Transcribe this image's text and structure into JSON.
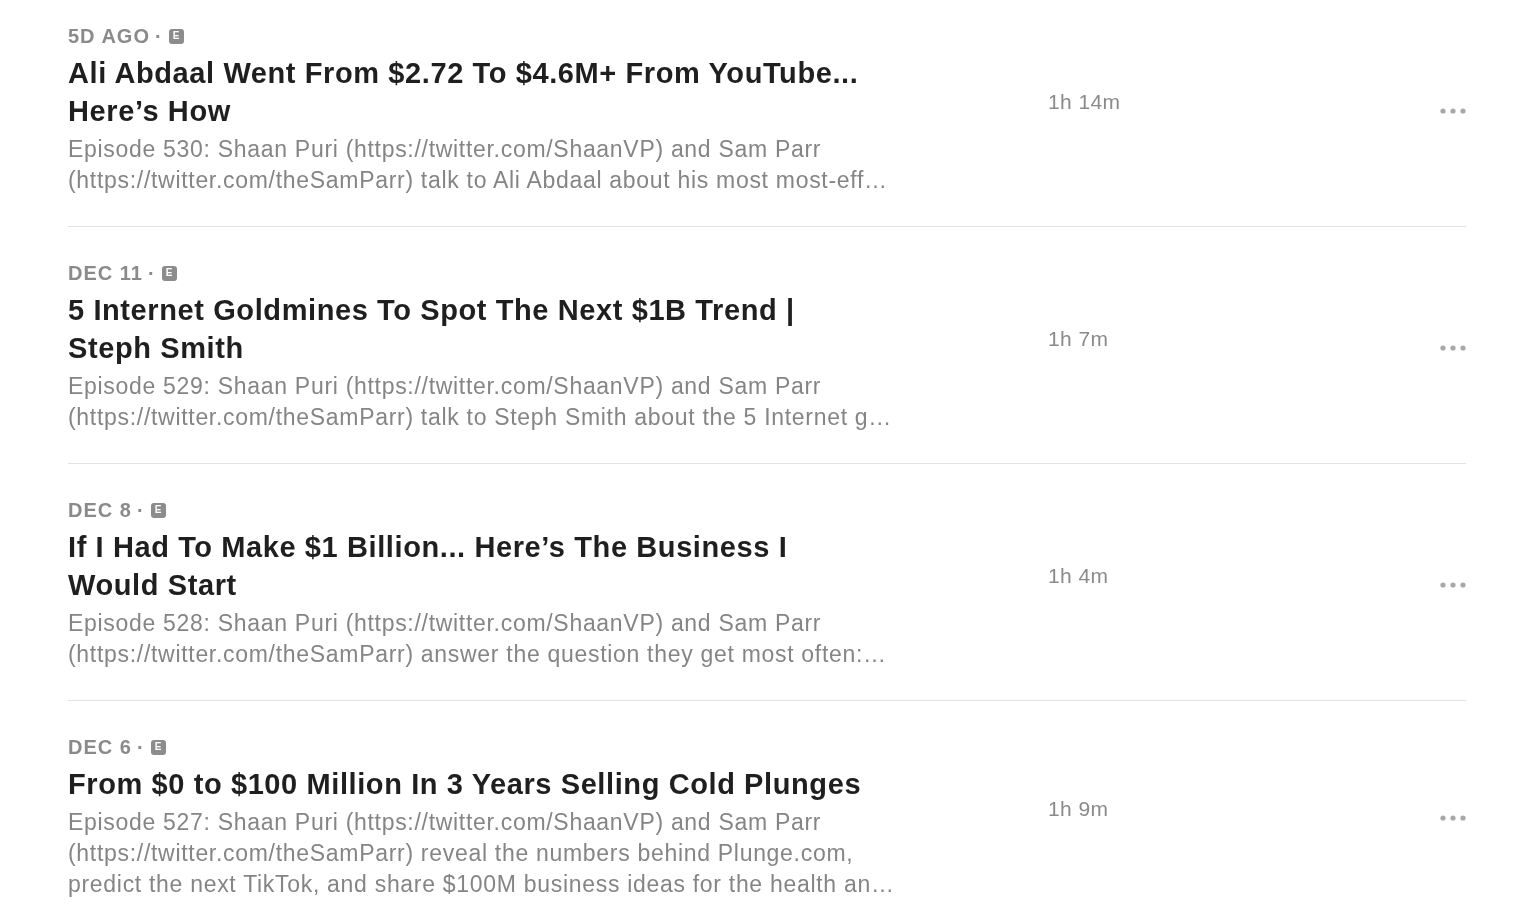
{
  "episodes": [
    {
      "date": "5D AGO",
      "separator": "·",
      "badge": "E",
      "title_lines": [
        "Ali Abdaal Went From $2.72 To $4.6M+ From YouTube...",
        "Here’s How"
      ],
      "description_lines": [
        "Episode 530: Shaan Puri (https://twitter.com/ShaanVP) and Sam Parr",
        "(https://twitter.com/theSamParr) talk to Ali Abdaal about his most most-eff…"
      ],
      "duration": "1h 14m"
    },
    {
      "date": "DEC 11",
      "separator": "·",
      "badge": "E",
      "title_lines": [
        "5 Internet Goldmines To Spot The Next $1B Trend |",
        "Steph Smith"
      ],
      "description_lines": [
        "Episode 529: Shaan Puri (https://twitter.com/ShaanVP) and Sam Parr",
        "(https://twitter.com/theSamParr) talk to Steph Smith about the 5 Internet g…"
      ],
      "duration": "1h 7m"
    },
    {
      "date": "DEC 8",
      "separator": "·",
      "badge": "E",
      "title_lines": [
        "If I Had To Make $1 Billion... Here’s The Business I",
        "Would Start"
      ],
      "description_lines": [
        "Episode 528: Shaan Puri (https://twitter.com/ShaanVP) and Sam Parr",
        "(https://twitter.com/theSamParr) answer the question they get most often:…"
      ],
      "duration": "1h 4m"
    },
    {
      "date": "DEC 6",
      "separator": "·",
      "badge": "E",
      "title_lines": [
        "From $0 to $100 Million In 3 Years Selling Cold Plunges"
      ],
      "description_lines": [
        "Episode 527: Shaan Puri (https://twitter.com/ShaanVP) and Sam Parr",
        "(https://twitter.com/theSamParr) reveal the numbers behind Plunge.com,",
        "predict the next TikTok, and share $100M business ideas for the health an…"
      ],
      "duration": "1h 9m"
    }
  ]
}
